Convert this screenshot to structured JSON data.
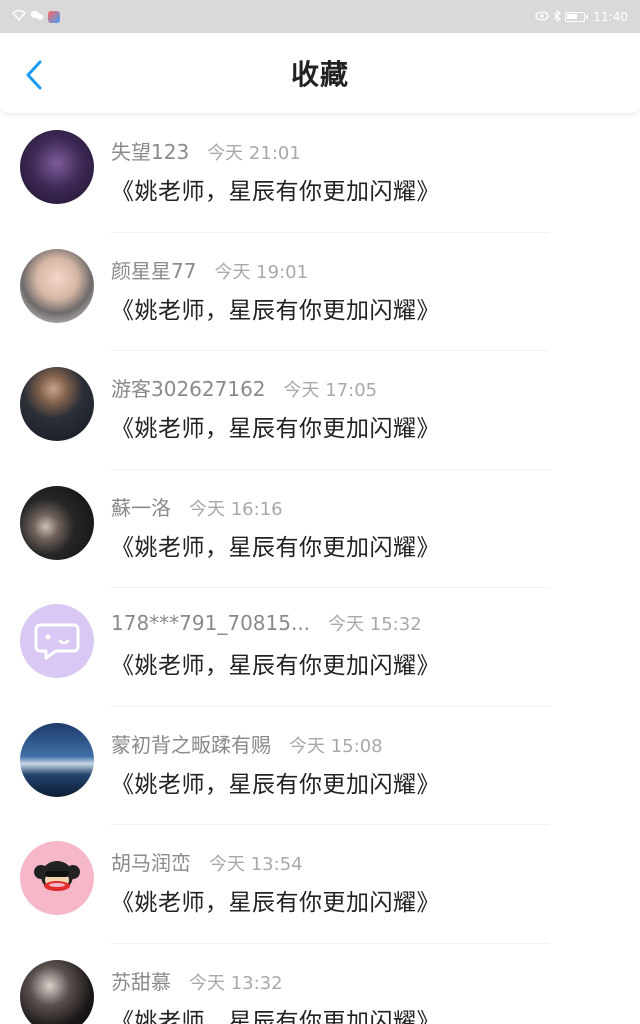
{
  "status_bar": {
    "time": "11:40"
  },
  "header": {
    "title": "收藏"
  },
  "items": [
    {
      "name": "失望123",
      "time": "今天 21:01",
      "message": "《姚老师，星辰有你更加闪耀》",
      "avatar": "purple-portrait"
    },
    {
      "name": "颜星星77",
      "time": "今天 19:01",
      "message": "《姚老师，星辰有你更加闪耀》",
      "avatar": "young-man-portrait"
    },
    {
      "name": "游客302627162",
      "time": "今天 17:05",
      "message": "《姚老师，星辰有你更加闪耀》",
      "avatar": "man-in-suit"
    },
    {
      "name": "蘇一洛",
      "time": "今天 16:16",
      "message": "《姚老师，星辰有你更加闪耀》",
      "avatar": "dark-portrait"
    },
    {
      "name": "178***791_70815...",
      "time": "今天 15:32",
      "message": "《姚老师，星辰有你更加闪耀》",
      "avatar": "chat-bubble-icon"
    },
    {
      "name": "蒙初背之畈蹂有赐",
      "time": "今天 15:08",
      "message": "《姚老师，星辰有你更加闪耀》",
      "avatar": "sea-scene"
    },
    {
      "name": "胡马润峦",
      "time": "今天 13:54",
      "message": "《姚老师，星辰有你更加闪耀》",
      "avatar": "monkey-cartoon"
    },
    {
      "name": "苏甜慕",
      "time": "今天 13:32",
      "message": "《姚老师，星辰有你更加闪耀》",
      "avatar": "girl-portrait"
    }
  ]
}
